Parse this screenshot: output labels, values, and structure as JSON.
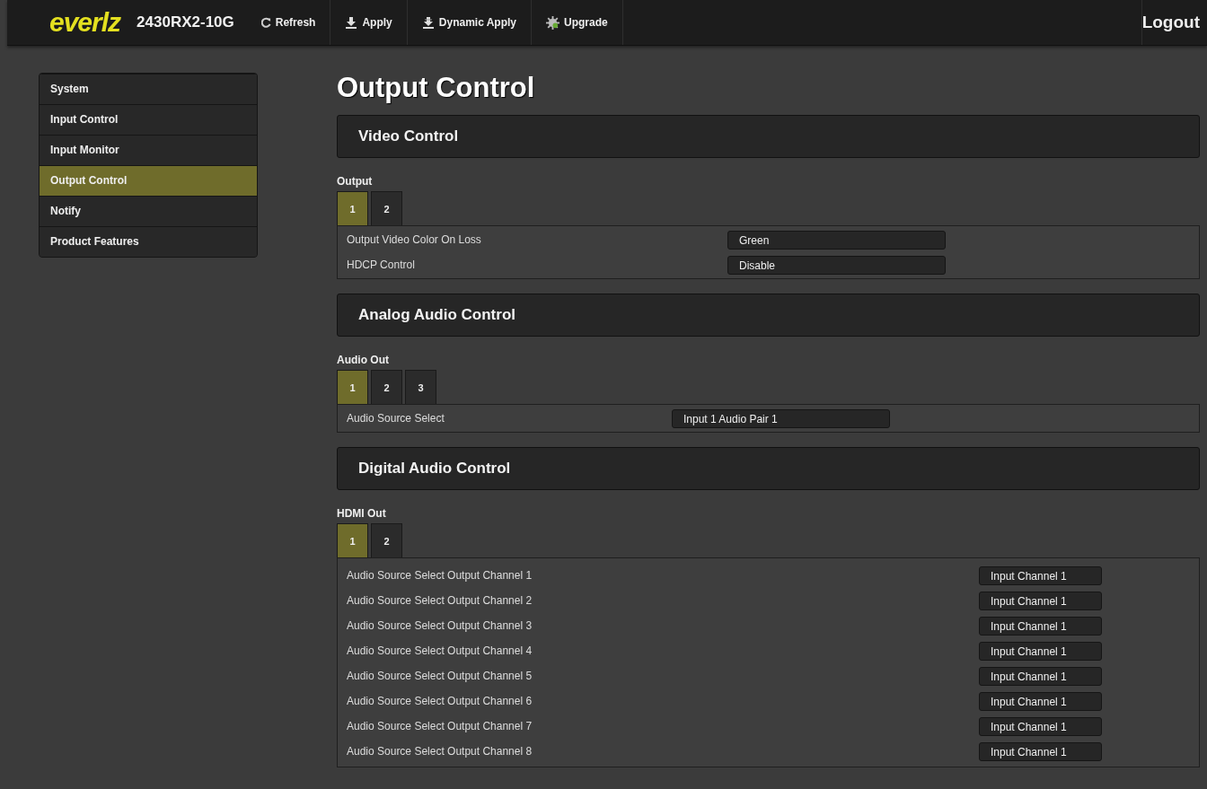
{
  "header": {
    "logo": "everlz",
    "device": "2430RX2-10G",
    "actions": [
      {
        "kind": "refresh",
        "label": "Refresh"
      },
      {
        "kind": "apply",
        "label": "Apply"
      },
      {
        "kind": "dynamic",
        "label": "Dynamic Apply"
      },
      {
        "kind": "upgrade",
        "label": "Upgrade"
      }
    ],
    "logout": "Logout"
  },
  "sidebar": {
    "items": [
      {
        "label": "System",
        "selected": false
      },
      {
        "label": "Input Control",
        "selected": false
      },
      {
        "label": "Input Monitor",
        "selected": false
      },
      {
        "label": "Output Control",
        "selected": true
      },
      {
        "label": "Notify",
        "selected": false
      },
      {
        "label": "Product Features",
        "selected": false
      }
    ]
  },
  "page_title": "Output Control",
  "sections": [
    {
      "title": "Video Control",
      "tab_group": "Output",
      "tabs": [
        {
          "label": "1",
          "selected": true
        },
        {
          "label": "2",
          "selected": false
        }
      ],
      "rows": [
        {
          "label": "Output Video Color On Loss",
          "value": "Green"
        },
        {
          "label": "HDCP Control",
          "value": "Disable"
        }
      ]
    },
    {
      "title": "Analog Audio Control",
      "tab_group": "Audio Out",
      "tabs": [
        {
          "label": "1",
          "selected": true
        },
        {
          "label": "2",
          "selected": false
        },
        {
          "label": "3",
          "selected": false
        }
      ],
      "rows": [
        {
          "label": "Audio Source Select",
          "value": "Input 1 Audio Pair 1"
        }
      ]
    },
    {
      "title": "Digital Audio Control",
      "tab_group": "HDMI Out",
      "tabs": [
        {
          "label": "1",
          "selected": true
        },
        {
          "label": "2",
          "selected": false
        }
      ],
      "rows": [
        {
          "label": "Audio Source Select Output Channel 1",
          "value": "Input Channel 1"
        },
        {
          "label": "Audio Source Select Output Channel 2",
          "value": "Input Channel 1"
        },
        {
          "label": "Audio Source Select Output Channel 3",
          "value": "Input Channel 1"
        },
        {
          "label": "Audio Source Select Output Channel 4",
          "value": "Input Channel 1"
        },
        {
          "label": "Audio Source Select Output Channel 5",
          "value": "Input Channel 1"
        },
        {
          "label": "Audio Source Select Output Channel 6",
          "value": "Input Channel 1"
        },
        {
          "label": "Audio Source Select Output Channel 7",
          "value": "Input Channel 1"
        },
        {
          "label": "Audio Source Select Output Channel 8",
          "value": "Input Channel 1"
        }
      ]
    }
  ]
}
